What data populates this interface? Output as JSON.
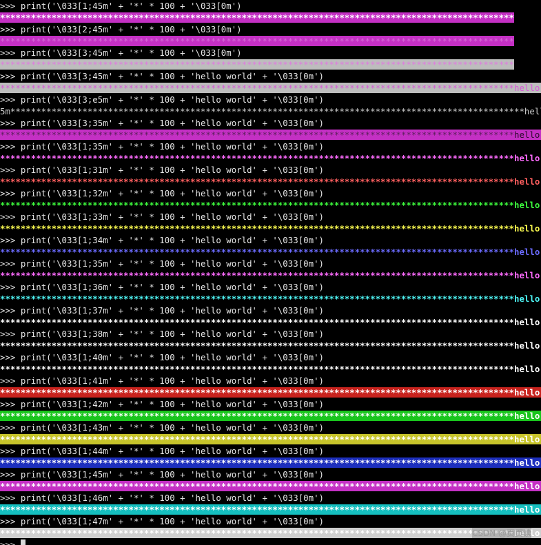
{
  "terminal": {
    "prompt": ">>>",
    "stars": "****************************************************************************************************",
    "watermark": "CSDN @页页读",
    "lines": [
      {
        "kind": "cmd",
        "text": "print('\\033[1;45m' + '*' * 100 + '\\033[0m')"
      },
      {
        "kind": "out",
        "star_color": "#ffffff",
        "star_bold": true,
        "bg": "#c430c4",
        "hello": ""
      },
      {
        "kind": "cmd",
        "text": "print('\\033[2;45m' + '*' * 100 + '\\033[0m')"
      },
      {
        "kind": "out",
        "star_color": "#d76bd7",
        "star_bold": false,
        "bg": "#c430c4",
        "hello": ""
      },
      {
        "kind": "cmd",
        "text": "print('\\033[3;45m' + '*' * 100 + '\\033[0m')"
      },
      {
        "kind": "out",
        "star_color": "#e07be0",
        "star_bold": false,
        "bg": "#bdbdbd",
        "hello": ""
      },
      {
        "kind": "cmd",
        "text": "print('\\033[3;45m' + '*' * 100 + 'hello world' + '\\033[0m')"
      },
      {
        "kind": "out",
        "star_color": "#d65ad6",
        "star_bold": false,
        "bg": "#bdbdbd",
        "hello": "hello world",
        "hello_color": "#d65ad6"
      },
      {
        "kind": "cmd",
        "text": "print('\\033[3;e5m' + '*' * 100 + 'hello world' + '\\033[0m')"
      },
      {
        "kind": "out",
        "prefix": "5m",
        "star_color": "#cfcfcf",
        "star_bold": false,
        "bg": "",
        "hello": "hello world",
        "hello_color": "#cfcfcf"
      },
      {
        "kind": "cmd",
        "text": "print('\\033[3;35m' + '*' * 100 + 'hello world' + '\\033[0m')"
      },
      {
        "kind": "out",
        "star_color": "#5a1f5a",
        "star_bold": false,
        "bg": "#c430c4",
        "hello": "hello world",
        "hello_color": "#2a0a2a"
      },
      {
        "kind": "cmd",
        "text": "print('\\033[1;35m' + '*' * 100 + 'hello world' + '\\033[0m')"
      },
      {
        "kind": "out",
        "star_color": "#ff6cff",
        "star_bold": true,
        "bg": "",
        "hello": "hello world",
        "hello_color": "#ff6cff"
      },
      {
        "kind": "cmd",
        "text": "print('\\033[1;31m' + '*' * 100 + 'hello world' + '\\033[0m')"
      },
      {
        "kind": "out",
        "star_color": "#ff5f5f",
        "star_bold": true,
        "bg": "",
        "hello": "hello world",
        "hello_color": "#ff5f5f"
      },
      {
        "kind": "cmd",
        "text": "print('\\033[1;32m' + '*' * 100 + 'hello world' + '\\033[0m')"
      },
      {
        "kind": "out",
        "star_color": "#3dfa3d",
        "star_bold": true,
        "bg": "",
        "hello": "hello world",
        "hello_color": "#3dfa3d"
      },
      {
        "kind": "cmd",
        "text": "print('\\033[1;33m' + '*' * 100 + 'hello world' + '\\033[0m')"
      },
      {
        "kind": "out",
        "star_color": "#fafa50",
        "star_bold": true,
        "bg": "",
        "hello": "hello world",
        "hello_color": "#fafa50"
      },
      {
        "kind": "cmd",
        "text": "print('\\033[1;34m' + '*' * 100 + 'hello world' + '\\033[0m')"
      },
      {
        "kind": "out",
        "star_color": "#6b6bff",
        "star_bold": true,
        "bg": "",
        "hello": "hello world",
        "hello_color": "#6b6bff"
      },
      {
        "kind": "cmd",
        "text": "print('\\033[1;35m' + '*' * 100 + 'hello world' + '\\033[0m')"
      },
      {
        "kind": "out",
        "star_color": "#ff6cff",
        "star_bold": true,
        "bg": "",
        "hello": "hello world",
        "hello_color": "#ff6cff"
      },
      {
        "kind": "cmd",
        "text": "print('\\033[1;36m' + '*' * 100 + 'hello world' + '\\033[0m')"
      },
      {
        "kind": "out",
        "star_color": "#4ff7f7",
        "star_bold": true,
        "bg": "",
        "hello": "hello world",
        "hello_color": "#4ff7f7"
      },
      {
        "kind": "cmd",
        "text": "print('\\033[1;37m' + '*' * 100 + 'hello world' + '\\033[0m')"
      },
      {
        "kind": "out",
        "star_color": "#ffffff",
        "star_bold": true,
        "bg": "",
        "hello": "hello world",
        "hello_color": "#ffffff"
      },
      {
        "kind": "cmd",
        "text": "print('\\033[1;38m' + '*' * 100 + 'hello world' + '\\033[0m')"
      },
      {
        "kind": "out",
        "star_color": "#ffffff",
        "star_bold": true,
        "bg": "",
        "hello": "hello world",
        "hello_color": "#ffffff"
      },
      {
        "kind": "cmd",
        "text": "print('\\033[1;40m' + '*' * 100 + 'hello world' + '\\033[0m')"
      },
      {
        "kind": "out",
        "star_color": "#ffffff",
        "star_bold": true,
        "bg": "",
        "hello": "hello world",
        "hello_color": "#ffffff"
      },
      {
        "kind": "cmd",
        "text": "print('\\033[1;41m' + '*' * 100 + 'hello world' + '\\033[0m')"
      },
      {
        "kind": "out",
        "star_color": "#ffffff",
        "star_bold": true,
        "bg": "#c8231e",
        "hello": "hello world",
        "hello_color": "#ffffff"
      },
      {
        "kind": "cmd",
        "text": "print('\\033[1;42m' + '*' * 100 + 'hello world' + '\\033[0m')"
      },
      {
        "kind": "out",
        "star_color": "#ffffff",
        "star_bold": true,
        "bg": "#19c51d",
        "hello": "hello world",
        "hello_color": "#ffffff"
      },
      {
        "kind": "cmd",
        "text": "print('\\033[1;43m' + '*' * 100 + 'hello world' + '\\033[0m')"
      },
      {
        "kind": "out",
        "star_color": "#ffffff",
        "star_bold": true,
        "bg": "#c7c42a",
        "hello": "hello world",
        "hello_color": "#ffffff"
      },
      {
        "kind": "cmd",
        "text": "print('\\033[1;44m' + '*' * 100 + 'hello world' + '\\033[0m')"
      },
      {
        "kind": "out",
        "star_color": "#ffffff",
        "star_bold": true,
        "bg": "#1d2fbd",
        "hello": "hello world",
        "hello_color": "#ffffff"
      },
      {
        "kind": "cmd",
        "text": "print('\\033[1;45m' + '*' * 100 + 'hello world' + '\\033[0m')"
      },
      {
        "kind": "out",
        "star_color": "#ffffff",
        "star_bold": true,
        "bg": "#c430c4",
        "hello": "hello world",
        "hello_color": "#ffffff"
      },
      {
        "kind": "cmd",
        "text": "print('\\033[1;46m' + '*' * 100 + 'hello world' + '\\033[0m')"
      },
      {
        "kind": "out",
        "star_color": "#ffffff",
        "star_bold": true,
        "bg": "#15bfbf",
        "hello": "hello world",
        "hello_color": "#ffffff"
      },
      {
        "kind": "cmd",
        "text": "print('\\033[1;47m' + '*' * 100 + 'hello world' + '\\033[0m')"
      },
      {
        "kind": "out",
        "star_color": "#ffffff",
        "star_bold": true,
        "bg": "#cfcfcf",
        "hello": "hello world",
        "hello_color": "#ffffff"
      }
    ]
  }
}
